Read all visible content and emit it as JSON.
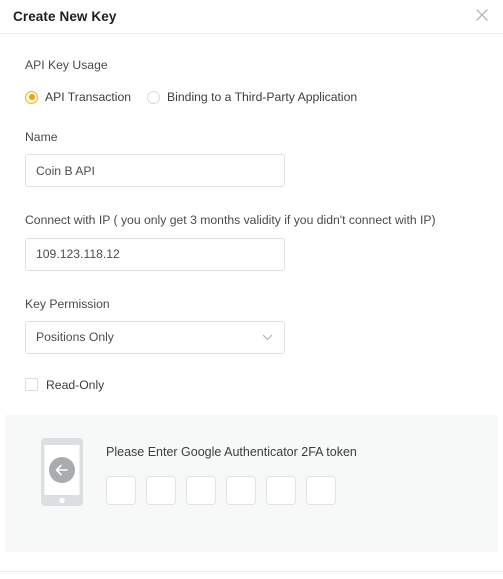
{
  "dialog": {
    "title": "Create New Key",
    "close_icon": "close-icon"
  },
  "usage": {
    "label": "API Key Usage",
    "options": [
      {
        "label": "API Transaction",
        "selected": true
      },
      {
        "label": "Binding to a Third-Party Application",
        "selected": false
      }
    ]
  },
  "name_field": {
    "label": "Name",
    "value": "Coin B API",
    "placeholder": ""
  },
  "ip_field": {
    "label": "Connect with IP ( you only get 3 months validity if you didn't connect with IP)",
    "value": "109.123.118.12",
    "placeholder": ""
  },
  "permission_field": {
    "label": "Key Permission",
    "value": "Positions Only",
    "caret_icon": "chevron-down-icon"
  },
  "read_only": {
    "label": "Read-Only",
    "checked": false
  },
  "twofa": {
    "icon": "mobile-phone-icon",
    "prompt": "Please Enter Google Authenticator 2FA token",
    "digits": [
      "",
      "",
      "",
      "",
      "",
      ""
    ]
  },
  "colors": {
    "accent": "#e8a317",
    "panel_background": "#f7f8f8",
    "border": "#e0e0e0",
    "text": "#3d3d3d"
  }
}
